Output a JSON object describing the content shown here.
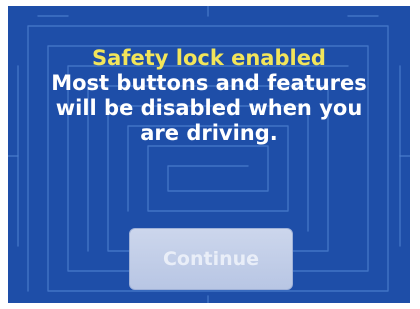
{
  "dialog": {
    "title": "Safety lock enabled",
    "message_lines": [
      "Most buttons and features",
      "will be disabled when you",
      "are driving."
    ],
    "continue_label": "Continue"
  },
  "colors": {
    "background": "#1e4ea8",
    "title": "#f2e55a",
    "text": "#ffffff",
    "button": "#c3cfea"
  }
}
